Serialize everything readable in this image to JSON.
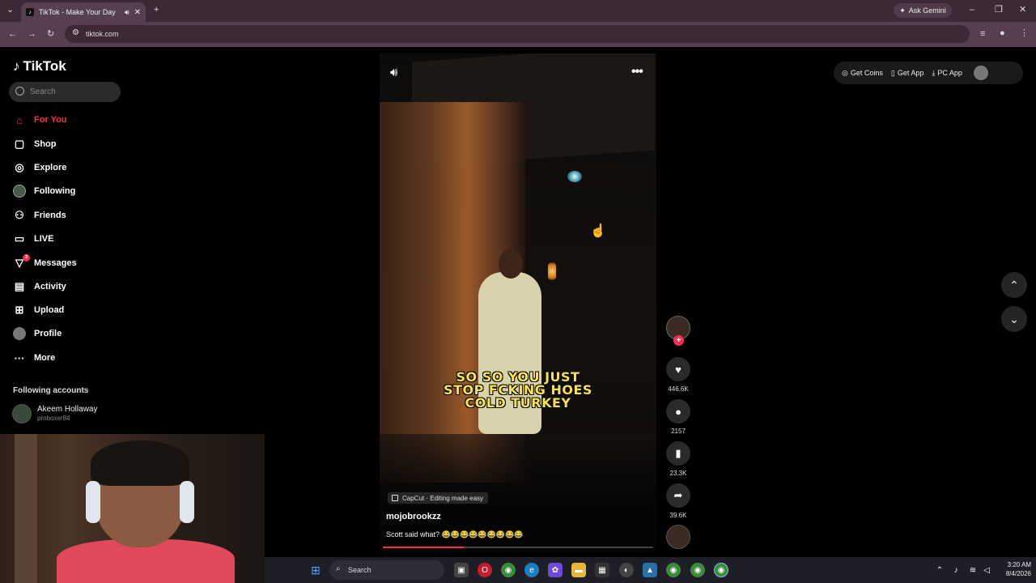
{
  "browser": {
    "tab_title": "TikTok - Make Your Day",
    "url": "tiktok.com",
    "gemini_label": "Ask Gemini"
  },
  "sidebar": {
    "logo": "TikTok",
    "search_placeholder": "Search",
    "items": [
      {
        "label": "For You",
        "icon": "home-icon",
        "active": true
      },
      {
        "label": "Shop",
        "icon": "shopping-bag-icon"
      },
      {
        "label": "Explore",
        "icon": "compass-icon"
      },
      {
        "label": "Following",
        "icon": "following-avatar-icon"
      },
      {
        "label": "Friends",
        "icon": "friends-icon"
      },
      {
        "label": "LIVE",
        "icon": "live-tv-icon"
      },
      {
        "label": "Messages",
        "icon": "paper-plane-icon",
        "badge": "3"
      },
      {
        "label": "Activity",
        "icon": "activity-icon"
      },
      {
        "label": "Upload",
        "icon": "upload-plus-icon"
      },
      {
        "label": "Profile",
        "icon": "profile-avatar-icon"
      },
      {
        "label": "More",
        "icon": "more-dots-icon"
      }
    ],
    "following_title": "Following accounts",
    "account": {
      "name": "Akeem Hollaway",
      "handle": "proboxer84"
    }
  },
  "video": {
    "caption_overlay_line1": "SO SO YOU JUST",
    "caption_overlay_line2": "STOP FCKING HOES",
    "caption_overlay_line3": "COLD TURKEY",
    "capcut_label": "CapCut · Editing made easy",
    "username": "mojobrookzz",
    "description": "Scott said what? 😂😂😂😂😂😂😂😂😂",
    "progress": 0.3
  },
  "actions": {
    "likes": "446.6K",
    "comments": "2157",
    "saves": "23.3K",
    "shares": "39.6K"
  },
  "top_right": {
    "coins_label": "Get Coins",
    "app_label": "Get App",
    "pc_label": "PC App"
  },
  "taskbar": {
    "search_label": "Search",
    "time": "3:20 AM",
    "date": "8/4/2026"
  },
  "colors": {
    "accent": "#fe2c55",
    "caption": "#f6e24a"
  }
}
